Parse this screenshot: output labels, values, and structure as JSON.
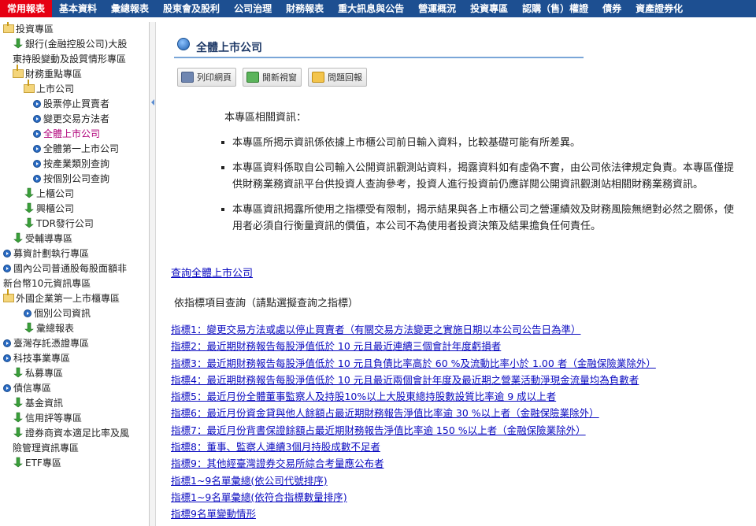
{
  "nav": {
    "items": [
      "常用報表",
      "基本資料",
      "彙總報表",
      "股東會及股利",
      "公司治理",
      "財務報表",
      "重大訊息與公告",
      "營運概況",
      "投資專區",
      "認購（售）權證",
      "債券",
      "資產證券化"
    ],
    "active_index": 0
  },
  "sidebar": {
    "items": [
      {
        "label": "投資專區",
        "icon": "folder-open-icon",
        "indent": 0
      },
      {
        "label": "銀行(金融控股公司)大股東持股變動及設質情形專區",
        "icon": "arrow-down-icon",
        "indent": 1
      },
      {
        "label": "財務重點專區",
        "icon": "folder-open-icon",
        "indent": 1
      },
      {
        "label": "上市公司",
        "icon": "folder-open-icon",
        "indent": 2
      },
      {
        "label": "股票停止買賣者",
        "icon": "bullet-icon",
        "indent": 3
      },
      {
        "label": "變更交易方法者",
        "icon": "bullet-icon",
        "indent": 3
      },
      {
        "label": "全體上市公司",
        "icon": "bullet-icon",
        "indent": 3,
        "current": true
      },
      {
        "label": "全體第一上市公司",
        "icon": "bullet-icon",
        "indent": 3
      },
      {
        "label": "按產業類別查詢",
        "icon": "bullet-icon",
        "indent": 3
      },
      {
        "label": "按個別公司查詢",
        "icon": "bullet-icon",
        "indent": 3
      },
      {
        "label": "上櫃公司",
        "icon": "arrow-down-icon",
        "indent": 2
      },
      {
        "label": "興櫃公司",
        "icon": "arrow-down-icon",
        "indent": 2
      },
      {
        "label": "TDR發行公司",
        "icon": "arrow-down-icon",
        "indent": 2
      },
      {
        "label": "受輔導專區",
        "icon": "arrow-down-icon",
        "indent": 1
      },
      {
        "label": "募資計劃執行專區",
        "icon": "bullet-icon",
        "indent": 0
      },
      {
        "label": "國內公司普通股每股面額非新台幣10元資訊專區",
        "icon": "bullet-icon",
        "indent": 0
      },
      {
        "label": "外國企業第一上市櫃專區",
        "icon": "folder-open-icon",
        "indent": 0
      },
      {
        "label": "個別公司資訊",
        "icon": "bullet-icon",
        "indent": 2
      },
      {
        "label": "彙總報表",
        "icon": "arrow-down-icon",
        "indent": 2
      },
      {
        "label": "臺灣存託憑證專區",
        "icon": "bullet-icon",
        "indent": 0
      },
      {
        "label": "科技事業專區",
        "icon": "bullet-icon",
        "indent": 0
      },
      {
        "label": "私募專區",
        "icon": "arrow-down-icon",
        "indent": 1
      },
      {
        "label": "債信專區",
        "icon": "bullet-icon",
        "indent": 0
      },
      {
        "label": "基金資訊",
        "icon": "arrow-down-icon",
        "indent": 1
      },
      {
        "label": "信用評等專區",
        "icon": "arrow-down-icon",
        "indent": 1
      },
      {
        "label": "證券商資本適足比率及風險管理資訊專區",
        "icon": "arrow-down-icon",
        "indent": 1
      },
      {
        "label": "ETF專區",
        "icon": "arrow-down-icon",
        "indent": 1
      }
    ]
  },
  "main": {
    "title": "全體上市公司",
    "buttons": [
      {
        "label": "列印網頁",
        "icon": "printer-icon"
      },
      {
        "label": "開新視窗",
        "icon": "new-window-icon"
      },
      {
        "label": "問題回報",
        "icon": "mail-icon"
      }
    ],
    "intro": "本專區相關資訊：",
    "notes": [
      "本專區所揭示資訊係依據上市櫃公司前日輸入資料，比較基礎可能有所差異。",
      "本專區資料係取自公司輸入公開資訊觀測站資料，揭露資料如有虛偽不實，由公司依法律規定負責。本專區僅提供財務業務資訊平台供投資人查詢參考，投資人進行投資前仍應詳閱公開資訊觀測站相關財務業務資訊。",
      "本專區資訊揭露所使用之指標受有限制，揭示結果與各上市櫃公司之營運績效及財務風險無絕對必然之關係，使用者必須自行衡量資訊的價值，本公司不為使用者投資決策及結果擔負任何責任。"
    ],
    "query_link": "查詢全體上市公司",
    "sub_heading": "依指標項目查詢（請點選擬查詢之指標）",
    "indicators": [
      "指標1：變更交易方法或處以停止買賣者（有關交易方法變更之實施日期以本公司公告日為準）",
      "指標2：最近期財務報告每股淨值低於 10 元且最近連續三個會計年度虧損者",
      "指標3：最近期財務報告每股淨值低於 10 元且負債比率高於 60 %及流動比率小於 1.00 者（金融保險業除外）",
      "指標4：最近期財務報告每股淨值低於 10 元且最近兩個會計年度及最近期之營業活動淨現金流量均為負數者",
      "指標5：最近月份全體董事監察人及持股10%以上大股東總持股數設質比率逾 9 成以上者",
      "指標6：最近月份資金貸與他人餘額占最近期財務報告淨值比率逾 30 %以上者（金融保險業除外）",
      "指標7：最近月份背書保證餘額占最近期財務報告淨值比率逾 150 %以上者（金融保險業除外）",
      "指標8：董事、監察人連續3個月持股成數不足者",
      "指標9：其他經臺灣證券交易所綜合考量應公布者",
      "指標1~9名單彙總(依公司代號排序)",
      "指標1~9名單彙總(依符合指標數量排序)",
      "指標9名單變動情形"
    ]
  },
  "colors": {
    "nav_bg": "#1d4f91",
    "nav_active": "#e60012",
    "link": "#0b0bc0",
    "current_item": "#b0007a"
  }
}
